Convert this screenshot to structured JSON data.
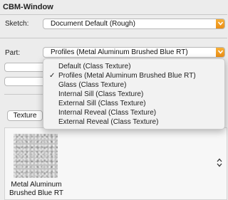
{
  "window": {
    "title": "CBM-Window"
  },
  "sketch": {
    "label": "Sketch:",
    "value": "Document Default (Rough)"
  },
  "part": {
    "label": "Part:",
    "value": "Profiles (Metal Aluminum Brushed Blue RT)",
    "options": [
      {
        "label": "Default (Class Texture)",
        "selected": false
      },
      {
        "label": "Profiles (Metal Aluminum Brushed Blue RT)",
        "selected": true
      },
      {
        "label": "Glass (Class Texture)",
        "selected": false
      },
      {
        "label": "Internal Sill (Class Texture)",
        "selected": false
      },
      {
        "label": "External Sill (Class Texture)",
        "selected": false
      },
      {
        "label": "Internal Reveal (Class Texture)",
        "selected": false
      },
      {
        "label": "External Reveal (Class Texture)",
        "selected": false
      }
    ],
    "check_glyph": "✓"
  },
  "texture": {
    "button_label": "Texture",
    "name_line1": "Metal Aluminum",
    "name_line2": "Brushed Blue RT"
  },
  "icons": {
    "popup_arrow": "chevron-down-icon",
    "stepper": "up-down-chevron-icon"
  },
  "colors": {
    "accent": "#f0a02a",
    "menu_bg": "#f2f2f2",
    "panel_bg": "#ececec"
  }
}
